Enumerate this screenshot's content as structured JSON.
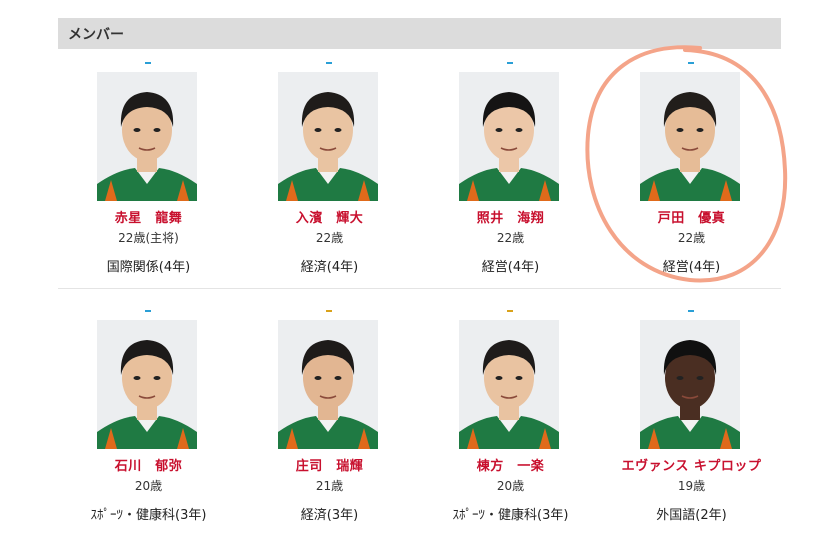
{
  "section": {
    "title": "メンバー"
  },
  "accent": {
    "dash_blue": "#2a9fd6",
    "dash_gold": "#d9a21b",
    "annotation": "#f4a489",
    "name_color": "#c8102e"
  },
  "members": [
    {
      "name": "赤星　龍舞",
      "age": "22歳(主将)",
      "dept": "国際関係(4年)",
      "dash": "blue",
      "skin": "#e7bf9c",
      "hair": "#1d1b1a"
    },
    {
      "name": "入濱　輝大",
      "age": "22歳",
      "dept": "経済(4年)",
      "dash": "blue",
      "skin": "#e9c4a2",
      "hair": "#1f1c1a"
    },
    {
      "name": "照井　海翔",
      "age": "22歳",
      "dept": "経営(4年)",
      "dash": "blue",
      "skin": "#ecc7a8",
      "hair": "#151414"
    },
    {
      "name": "戸田　優真",
      "age": "22歳",
      "dept": "経営(4年)",
      "dash": "blue",
      "skin": "#e6bc97",
      "hair": "#221e1b"
    },
    {
      "name": "石川　郁弥",
      "age": "20歳",
      "dept": "ｽﾎﾟｰﾂ・健康科(3年)",
      "dash": "blue",
      "skin": "#e8c09c",
      "hair": "#1c1a19"
    },
    {
      "name": "庄司　瑞輝",
      "age": "21歳",
      "dept": "経済(3年)",
      "dash": "gold",
      "skin": "#e2b692",
      "hair": "#1e1b19"
    },
    {
      "name": "棟方　一楽",
      "age": "20歳",
      "dept": "ｽﾎﾟｰﾂ・健康科(3年)",
      "dash": "gold",
      "skin": "#e9c3a1",
      "hair": "#1e1b1a"
    },
    {
      "name": "エヴァンス キプロップ",
      "age": "19歳",
      "dept": "外国語(2年)",
      "dash": "blue",
      "skin": "#4a2e22",
      "hair": "#101010"
    }
  ]
}
